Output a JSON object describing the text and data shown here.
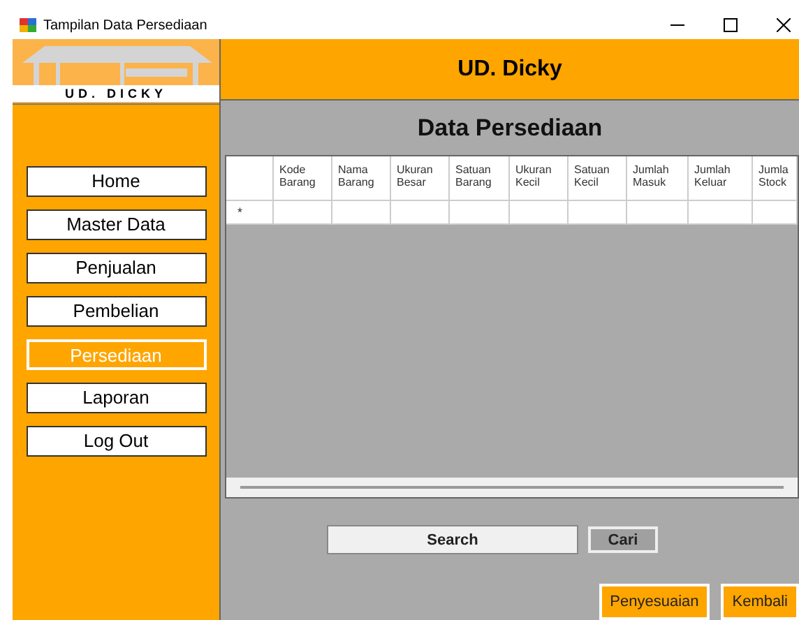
{
  "window": {
    "title": "Tampilan Data Persediaan"
  },
  "logo": {
    "caption": "UD. DICKY"
  },
  "header": {
    "title": "UD. Dicky"
  },
  "sidebar": {
    "items": [
      {
        "label": "Home",
        "selected": false
      },
      {
        "label": "Master Data",
        "selected": false
      },
      {
        "label": "Penjualan",
        "selected": false
      },
      {
        "label": "Pembelian",
        "selected": false
      },
      {
        "label": "Persediaan",
        "selected": true
      },
      {
        "label": "Laporan",
        "selected": false
      },
      {
        "label": "Log Out",
        "selected": false
      }
    ]
  },
  "content": {
    "title": "Data Persediaan"
  },
  "table": {
    "columns": [
      "Kode Barang",
      "Nama Barang",
      "Ukuran Besar",
      "Satuan Barang",
      "Ukuran Kecil",
      "Satuan Kecil",
      "Jumlah Masuk",
      "Jumlah Keluar",
      "Jumla Stock"
    ],
    "new_row_marker": "*"
  },
  "search": {
    "value": "Search",
    "button": "Cari"
  },
  "buttons": [
    "Penyesuaian",
    "Kembali"
  ]
}
